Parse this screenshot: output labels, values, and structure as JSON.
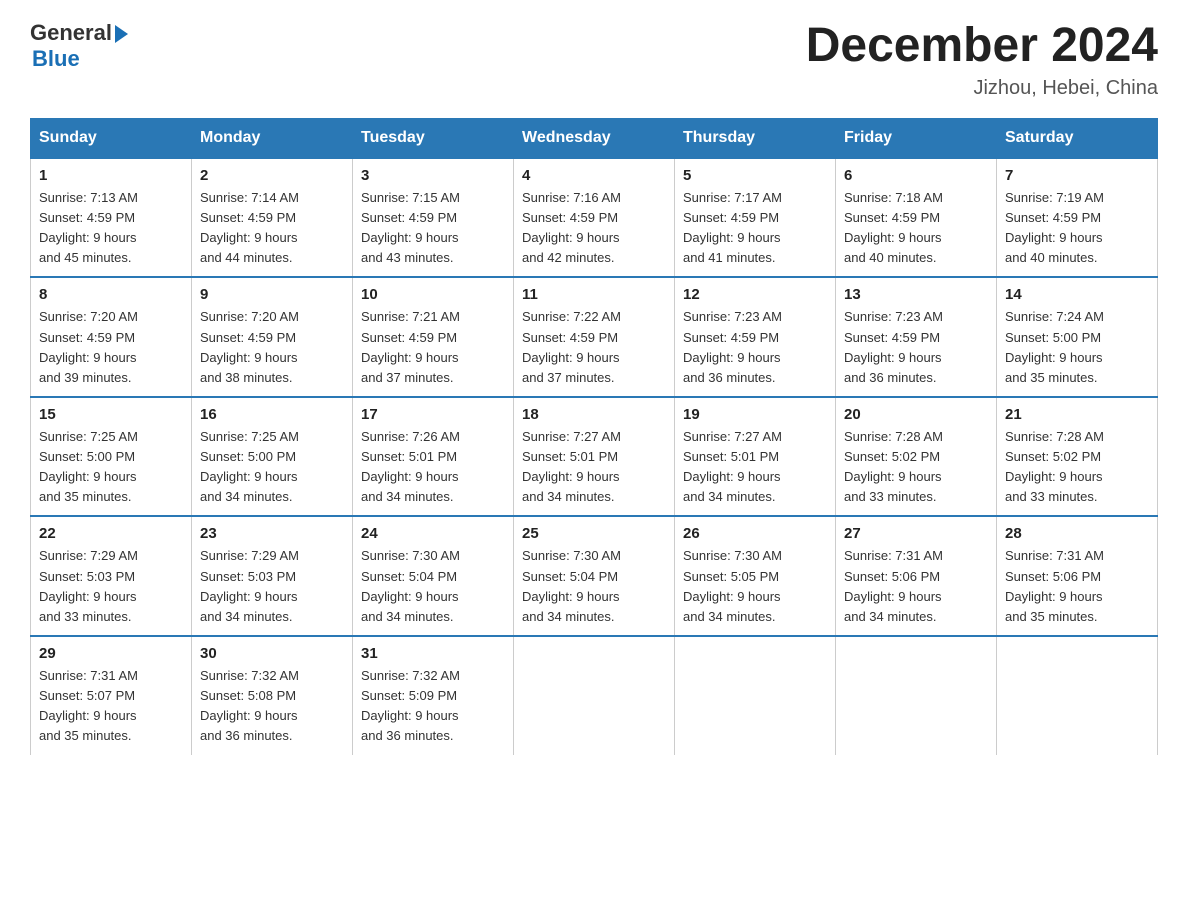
{
  "logo": {
    "line1": "General",
    "arrow": "▶",
    "line2": "Blue"
  },
  "title": "December 2024",
  "location": "Jizhou, Hebei, China",
  "days_header": [
    "Sunday",
    "Monday",
    "Tuesday",
    "Wednesday",
    "Thursday",
    "Friday",
    "Saturday"
  ],
  "weeks": [
    [
      {
        "day": "1",
        "sunrise": "7:13 AM",
        "sunset": "4:59 PM",
        "daylight": "9 hours and 45 minutes."
      },
      {
        "day": "2",
        "sunrise": "7:14 AM",
        "sunset": "4:59 PM",
        "daylight": "9 hours and 44 minutes."
      },
      {
        "day": "3",
        "sunrise": "7:15 AM",
        "sunset": "4:59 PM",
        "daylight": "9 hours and 43 minutes."
      },
      {
        "day": "4",
        "sunrise": "7:16 AM",
        "sunset": "4:59 PM",
        "daylight": "9 hours and 42 minutes."
      },
      {
        "day": "5",
        "sunrise": "7:17 AM",
        "sunset": "4:59 PM",
        "daylight": "9 hours and 41 minutes."
      },
      {
        "day": "6",
        "sunrise": "7:18 AM",
        "sunset": "4:59 PM",
        "daylight": "9 hours and 40 minutes."
      },
      {
        "day": "7",
        "sunrise": "7:19 AM",
        "sunset": "4:59 PM",
        "daylight": "9 hours and 40 minutes."
      }
    ],
    [
      {
        "day": "8",
        "sunrise": "7:20 AM",
        "sunset": "4:59 PM",
        "daylight": "9 hours and 39 minutes."
      },
      {
        "day": "9",
        "sunrise": "7:20 AM",
        "sunset": "4:59 PM",
        "daylight": "9 hours and 38 minutes."
      },
      {
        "day": "10",
        "sunrise": "7:21 AM",
        "sunset": "4:59 PM",
        "daylight": "9 hours and 37 minutes."
      },
      {
        "day": "11",
        "sunrise": "7:22 AM",
        "sunset": "4:59 PM",
        "daylight": "9 hours and 37 minutes."
      },
      {
        "day": "12",
        "sunrise": "7:23 AM",
        "sunset": "4:59 PM",
        "daylight": "9 hours and 36 minutes."
      },
      {
        "day": "13",
        "sunrise": "7:23 AM",
        "sunset": "4:59 PM",
        "daylight": "9 hours and 36 minutes."
      },
      {
        "day": "14",
        "sunrise": "7:24 AM",
        "sunset": "5:00 PM",
        "daylight": "9 hours and 35 minutes."
      }
    ],
    [
      {
        "day": "15",
        "sunrise": "7:25 AM",
        "sunset": "5:00 PM",
        "daylight": "9 hours and 35 minutes."
      },
      {
        "day": "16",
        "sunrise": "7:25 AM",
        "sunset": "5:00 PM",
        "daylight": "9 hours and 34 minutes."
      },
      {
        "day": "17",
        "sunrise": "7:26 AM",
        "sunset": "5:01 PM",
        "daylight": "9 hours and 34 minutes."
      },
      {
        "day": "18",
        "sunrise": "7:27 AM",
        "sunset": "5:01 PM",
        "daylight": "9 hours and 34 minutes."
      },
      {
        "day": "19",
        "sunrise": "7:27 AM",
        "sunset": "5:01 PM",
        "daylight": "9 hours and 34 minutes."
      },
      {
        "day": "20",
        "sunrise": "7:28 AM",
        "sunset": "5:02 PM",
        "daylight": "9 hours and 33 minutes."
      },
      {
        "day": "21",
        "sunrise": "7:28 AM",
        "sunset": "5:02 PM",
        "daylight": "9 hours and 33 minutes."
      }
    ],
    [
      {
        "day": "22",
        "sunrise": "7:29 AM",
        "sunset": "5:03 PM",
        "daylight": "9 hours and 33 minutes."
      },
      {
        "day": "23",
        "sunrise": "7:29 AM",
        "sunset": "5:03 PM",
        "daylight": "9 hours and 34 minutes."
      },
      {
        "day": "24",
        "sunrise": "7:30 AM",
        "sunset": "5:04 PM",
        "daylight": "9 hours and 34 minutes."
      },
      {
        "day": "25",
        "sunrise": "7:30 AM",
        "sunset": "5:04 PM",
        "daylight": "9 hours and 34 minutes."
      },
      {
        "day": "26",
        "sunrise": "7:30 AM",
        "sunset": "5:05 PM",
        "daylight": "9 hours and 34 minutes."
      },
      {
        "day": "27",
        "sunrise": "7:31 AM",
        "sunset": "5:06 PM",
        "daylight": "9 hours and 34 minutes."
      },
      {
        "day": "28",
        "sunrise": "7:31 AM",
        "sunset": "5:06 PM",
        "daylight": "9 hours and 35 minutes."
      }
    ],
    [
      {
        "day": "29",
        "sunrise": "7:31 AM",
        "sunset": "5:07 PM",
        "daylight": "9 hours and 35 minutes."
      },
      {
        "day": "30",
        "sunrise": "7:32 AM",
        "sunset": "5:08 PM",
        "daylight": "9 hours and 36 minutes."
      },
      {
        "day": "31",
        "sunrise": "7:32 AM",
        "sunset": "5:09 PM",
        "daylight": "9 hours and 36 minutes."
      },
      null,
      null,
      null,
      null
    ]
  ],
  "labels": {
    "sunrise": "Sunrise:",
    "sunset": "Sunset:",
    "daylight": "Daylight:"
  }
}
